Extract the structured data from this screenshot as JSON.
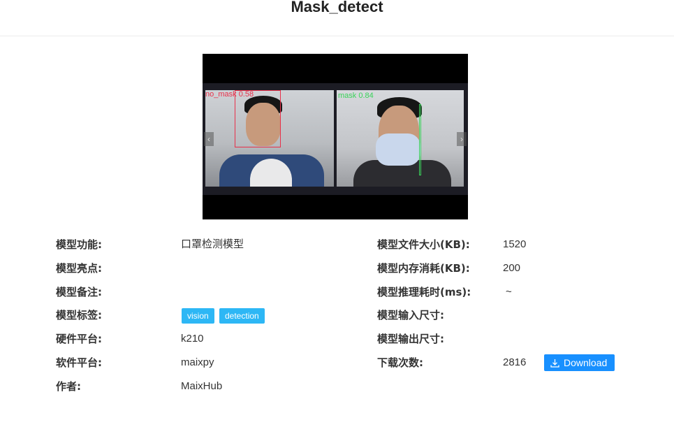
{
  "page": {
    "title": "Mask_detect"
  },
  "preview": {
    "left_label": "no_mask 0.58",
    "right_label": "mask 0.84",
    "no_mask_color": "#e8304a",
    "mask_color": "#3ad35a"
  },
  "details": {
    "left": [
      {
        "label": "模型功能:",
        "value": "口罩检测模型"
      },
      {
        "label": "模型亮点:",
        "value": ""
      },
      {
        "label": "模型备注:",
        "value": ""
      },
      {
        "label": "模型标签:",
        "tags": [
          "vision",
          "detection"
        ]
      },
      {
        "label": "硬件平台:",
        "value": "k210"
      },
      {
        "label": "软件平台:",
        "value": "maixpy"
      },
      {
        "label": "作者:",
        "value": "MaixHub"
      }
    ],
    "right": [
      {
        "label": "模型文件大小(KB):",
        "value": "1520"
      },
      {
        "label": "模型内存消耗(KB):",
        "value": "200"
      },
      {
        "label": "模型推理耗时(ms):",
        "value": "~"
      },
      {
        "label": "模型输入尺寸:",
        "value": ""
      },
      {
        "label": "模型输出尺寸:",
        "value": ""
      },
      {
        "label": "下载次数:",
        "value": "2816"
      }
    ]
  },
  "download": {
    "label": "Download",
    "icon": "download-icon",
    "color": "#1890ff"
  },
  "tag_color": "#2db7f5"
}
